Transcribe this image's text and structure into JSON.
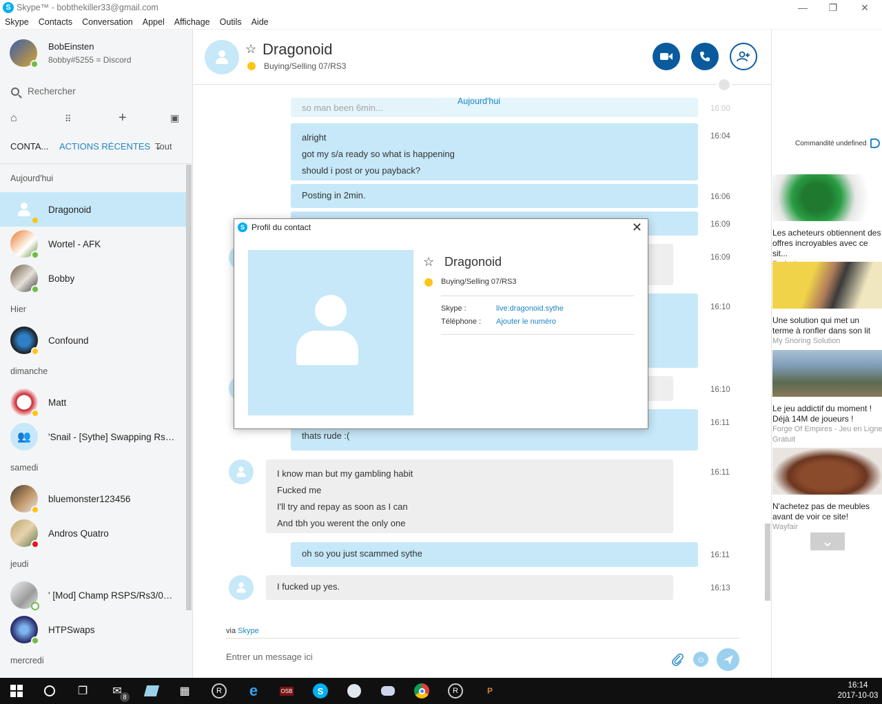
{
  "window": {
    "title": "Skype™ - bobthekiller33@gmail.com",
    "controls": {
      "minimize": "—",
      "maximize": "❐",
      "close": "✕"
    }
  },
  "menubar": [
    "Skype",
    "Contacts",
    "Conversation",
    "Appel",
    "Affichage",
    "Outils",
    "Aide"
  ],
  "profile": {
    "name": "BobEinsten",
    "mood": "8obby#5255 = Discord",
    "status": "online"
  },
  "search": {
    "placeholder": "Rechercher"
  },
  "tabs": {
    "contacts": "CONTA...",
    "recent": "ACTIONS RÉCENTES",
    "filter": "Tout"
  },
  "contacts": {
    "groups": [
      {
        "label": "Aujourd'hui",
        "items": [
          {
            "name": "Dragonoid",
            "status": "away",
            "selected": true
          },
          {
            "name": "Wortel - AFK",
            "status": "online"
          },
          {
            "name": "Bobby",
            "status": "online"
          }
        ]
      },
      {
        "label": "Hier",
        "items": [
          {
            "name": "Confound",
            "status": "away"
          }
        ]
      },
      {
        "label": "dimanche",
        "items": [
          {
            "name": "Matt",
            "status": "away"
          },
          {
            "name": "'Snail - [Sythe] Swapping Rs3...",
            "status": "group"
          }
        ]
      },
      {
        "label": "samedi",
        "items": [
          {
            "name": "bluemonster123456",
            "status": "away"
          },
          {
            "name": "Andros Quatro",
            "status": "busy"
          }
        ]
      },
      {
        "label": "jeudi",
        "items": [
          {
            "name": "' [Mod] Champ RSPS/Rs3/07...",
            "status": "offline"
          },
          {
            "name": "HTPSwaps",
            "status": "online"
          }
        ]
      },
      {
        "label": "mercredi",
        "items": []
      }
    ]
  },
  "chat": {
    "contact_name": "Dragonoid",
    "mood": "Buying/Selling 07/RS3",
    "day_separator": "Aujourd'hui",
    "messages": [
      {
        "dir": "out",
        "lines": [
          "so man been 6min..."
        ],
        "time": "16:00"
      },
      {
        "dir": "out",
        "lines": [
          "alright",
          "got my s/a ready so what is happening",
          "should i post or you payback?"
        ],
        "time": "16:04"
      },
      {
        "dir": "out",
        "lines": [
          "Posting in 2min."
        ],
        "time": "16:06"
      },
      {
        "dir": "out",
        "lines": [
          ""
        ],
        "time": "16:09"
      },
      {
        "dir": "in",
        "lines": [
          ""
        ],
        "time": "16:09"
      },
      {
        "dir": "out",
        "lines": [
          ""
        ],
        "time": "16:10"
      },
      {
        "dir": "in",
        "lines": [
          ""
        ],
        "time": "16:10"
      },
      {
        "dir": "out",
        "lines": [
          "thats rude :("
        ],
        "time": "16:11"
      },
      {
        "dir": "in",
        "lines": [
          "I know man but my gambling habit",
          "Fucked me",
          "I'll try and repay as soon as I can",
          "And tbh you werent the only one"
        ],
        "time": "16:11"
      },
      {
        "dir": "out",
        "lines": [
          "oh so you just scammed sythe"
        ],
        "time": "16:11"
      },
      {
        "dir": "in",
        "lines": [
          "I fucked up yes."
        ],
        "time": "16:13"
      }
    ],
    "via_prefix": "via",
    "via_link": "Skype",
    "compose_placeholder": "Entrer un message ici"
  },
  "ads": {
    "label": "Commandité undefined",
    "items": [
      {
        "title": "Les acheteurs obtiennent des offres incroyables avec ce sit...",
        "source": "Tophatter",
        "colors": [
          "#1f7a2f",
          "#e6e6e6"
        ]
      },
      {
        "title": "Une solution qui met un terme à ronfler dans son lit",
        "source": "My Snoring Solution",
        "colors": [
          "#f1d34a",
          "#b07d5a"
        ]
      },
      {
        "title": "Le jeu addictif du moment ! Déjà 14M de joueurs !",
        "source": "Forge Of Empires - Jeu en Ligne Gratuit",
        "colors": [
          "#7e9bb5",
          "#5c6a4f"
        ]
      },
      {
        "title": "N'achetez pas de meubles avant de voir ce site!",
        "source": "Wayfair",
        "colors": [
          "#8a4a2c",
          "#e9e4df"
        ]
      }
    ],
    "more_icon": "chevron-down-icon"
  },
  "dialog": {
    "title": "Profil du contact",
    "name": "Dragonoid",
    "mood": "Buying/Selling 07/RS3",
    "skype_label": "Skype :",
    "skype_value": "live:dragonoid.sythe",
    "phone_label": "Téléphone :",
    "phone_value": "Ajouter le numéro"
  },
  "taskbar": {
    "mail_badge": "8",
    "osb_label": "OSB",
    "time": "16:14",
    "date": "2017-10-03"
  },
  "colors": {
    "accent": "#0a5b9d",
    "skype_blue": "#00aff0",
    "selected_row": "#c6e8f8",
    "outgoing_bubble": "#c6e8f8",
    "incoming_bubble": "#eeeeef",
    "link": "#1e86c7",
    "away": "#ffc414",
    "online": "#6cbd45",
    "busy": "#e81123"
  }
}
